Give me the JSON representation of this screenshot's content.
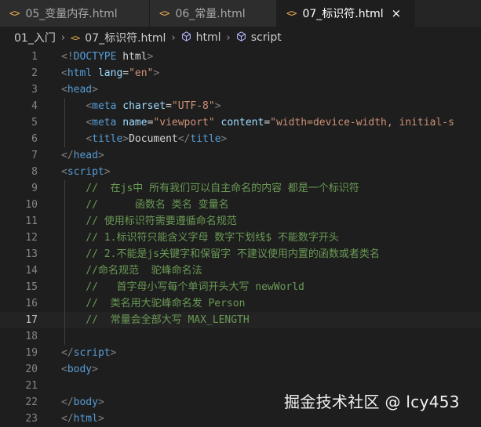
{
  "tabs": [
    {
      "icon": "<>",
      "label": "05_变量内存.html",
      "active": false
    },
    {
      "icon": "<>",
      "label": "06_常量.html",
      "active": false
    },
    {
      "icon": "<>",
      "label": "07_标识符.html",
      "active": true,
      "close": "×"
    }
  ],
  "breadcrumb": {
    "folder": "01_入门",
    "file_icon": "<>",
    "file": "07_标识符.html",
    "node1": "html",
    "node2": "script",
    "separator": "›"
  },
  "editor": {
    "current_line": "17",
    "lines": [
      {
        "n": "1",
        "tokens": [
          [
            "p",
            "<!"
          ],
          [
            "d",
            "DOCTYPE"
          ],
          [
            "t",
            " html"
          ],
          [
            "p",
            ">"
          ]
        ]
      },
      {
        "n": "2",
        "tokens": [
          [
            "p",
            "<"
          ],
          [
            "g",
            "html"
          ],
          [
            "a",
            " lang"
          ],
          [
            "t",
            "="
          ],
          [
            "s",
            "\"en\""
          ],
          [
            "p",
            ">"
          ]
        ]
      },
      {
        "n": "3",
        "tokens": [
          [
            "p",
            "<"
          ],
          [
            "g",
            "head"
          ],
          [
            "p",
            ">"
          ]
        ]
      },
      {
        "n": "4",
        "tokens": [
          [
            "t",
            "    "
          ],
          [
            "p",
            "<"
          ],
          [
            "g",
            "meta"
          ],
          [
            "a",
            " charset"
          ],
          [
            "t",
            "="
          ],
          [
            "s",
            "\"UTF-8\""
          ],
          [
            "p",
            ">"
          ]
        ]
      },
      {
        "n": "5",
        "tokens": [
          [
            "t",
            "    "
          ],
          [
            "p",
            "<"
          ],
          [
            "g",
            "meta"
          ],
          [
            "a",
            " name"
          ],
          [
            "t",
            "="
          ],
          [
            "s",
            "\"viewport\""
          ],
          [
            "a",
            " content"
          ],
          [
            "t",
            "="
          ],
          [
            "s",
            "\"width=device-width, initial-s"
          ]
        ]
      },
      {
        "n": "6",
        "tokens": [
          [
            "t",
            "    "
          ],
          [
            "p",
            "<"
          ],
          [
            "g",
            "title"
          ],
          [
            "p",
            ">"
          ],
          [
            "t",
            "Document"
          ],
          [
            "p",
            "</"
          ],
          [
            "g",
            "title"
          ],
          [
            "p",
            ">"
          ]
        ]
      },
      {
        "n": "7",
        "tokens": [
          [
            "p",
            "</"
          ],
          [
            "g",
            "head"
          ],
          [
            "p",
            ">"
          ]
        ]
      },
      {
        "n": "8",
        "tokens": [
          [
            "p",
            "<"
          ],
          [
            "g",
            "script"
          ],
          [
            "p",
            ">"
          ]
        ]
      },
      {
        "n": "9",
        "tokens": [
          [
            "c",
            "    //  在js中 所有我们可以自主命名的内容 都是一个标识符"
          ]
        ]
      },
      {
        "n": "10",
        "tokens": [
          [
            "c",
            "    //      函数名 类名 变量名"
          ]
        ]
      },
      {
        "n": "11",
        "tokens": [
          [
            "c",
            "    // 使用标识符需要遵循命名规范"
          ]
        ]
      },
      {
        "n": "12",
        "tokens": [
          [
            "c",
            "    // 1.标识符只能含义字母 数字下划线$ 不能数字开头"
          ]
        ]
      },
      {
        "n": "13",
        "tokens": [
          [
            "c",
            "    // 2.不能是js关键字和保留字 不建议使用内置的函数或者类名"
          ]
        ]
      },
      {
        "n": "14",
        "tokens": [
          [
            "c",
            "    //命名规范  驼峰命名法"
          ]
        ]
      },
      {
        "n": "15",
        "tokens": [
          [
            "c",
            "    //   首字母小写每个单词开头大写 newWorld"
          ]
        ]
      },
      {
        "n": "16",
        "tokens": [
          [
            "c",
            "    //  类名用大驼峰命名发 Person"
          ]
        ]
      },
      {
        "n": "17",
        "tokens": [
          [
            "c",
            "    //  常量会全部大写 MAX_LENGTH"
          ]
        ]
      },
      {
        "n": "18",
        "tokens": []
      },
      {
        "n": "19",
        "tokens": [
          [
            "p",
            "</"
          ],
          [
            "g",
            "script"
          ],
          [
            "p",
            ">"
          ]
        ]
      },
      {
        "n": "20",
        "tokens": [
          [
            "p",
            "<"
          ],
          [
            "g",
            "body"
          ],
          [
            "p",
            ">"
          ]
        ]
      },
      {
        "n": "21",
        "tokens": []
      },
      {
        "n": "22",
        "tokens": [
          [
            "p",
            "</"
          ],
          [
            "g",
            "body"
          ],
          [
            "p",
            ">"
          ]
        ]
      },
      {
        "n": "23",
        "tokens": [
          [
            "p",
            "</"
          ],
          [
            "g",
            "html"
          ],
          [
            "p",
            ">"
          ]
        ]
      }
    ]
  },
  "watermark": "掘金技术社区 @ lcy453",
  "colors": {
    "background": "#1e1e1e",
    "tag": "#569cd6",
    "attribute": "#9cdcfe",
    "string": "#ce9178",
    "comment": "#6a9955",
    "tab_icon": "#e8ab53"
  }
}
